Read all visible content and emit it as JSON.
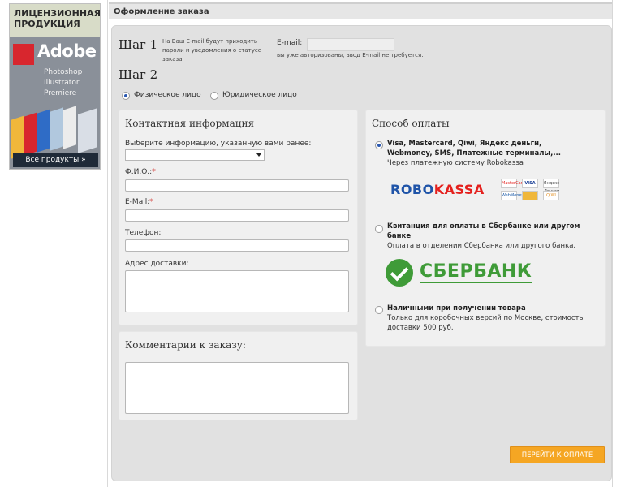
{
  "banner": {
    "heading": "ЛИЦЕНЗИОННАЯ ПРОДУКЦИЯ",
    "brand": "Adobe",
    "products": [
      "Photoshop",
      "Illustrator",
      "Premiere"
    ],
    "button": "Все продукты »"
  },
  "section": {
    "title": "Оформление заказа"
  },
  "step1": {
    "label": "Шаг 1",
    "note": "На Ваш E-mail будут приходить пароли и уведомления о статусе заказа.",
    "email_label": "E-mail:",
    "email_value": "",
    "email_note": "вы уже авторизованы, ввод E-mail не требуется."
  },
  "step2": {
    "label": "Шаг 2",
    "person_individual": "Физическое лицо",
    "person_legal": "Юридическое лицо"
  },
  "contact": {
    "title": "Контактная информация",
    "select_label": "Выберите информацию, указанную вами ранее:",
    "name_label": "Ф.И.О.:",
    "email_label": "E-Mail:",
    "phone_label": "Телефон:",
    "address_label": "Адрес доставки:",
    "required_mark": "*"
  },
  "comments": {
    "title": "Комментарии к заказу:"
  },
  "payment": {
    "title": "Способ оплаты",
    "options": [
      {
        "title": "Visa, Mastercard, Qiwi, Яндекс деньги, Webmoney, SMS, Платежные терминалы,...",
        "desc": "Через платежную систему Robokassa",
        "selected": true
      },
      {
        "title": "Квитанция для оплаты в Сбербанке или другом банке",
        "desc": "Оплата в отделении Сбербанка или другого банка.",
        "selected": false
      },
      {
        "title": "Наличными при получении товара",
        "desc": "Только для коробочных версий по Москве, стоимость доставки 500 руб.",
        "selected": false
      }
    ],
    "robokassa_a": "ROBO",
    "robokassa_b": "KASSA",
    "sberbank": "СБЕРБАНК",
    "cards": [
      "MasterCard",
      "VISA",
      "Яндекс Деньги",
      "WebMoney",
      "",
      "QIWI"
    ]
  },
  "submit": {
    "label": "ПЕРЕЙТИ К ОПЛАТЕ"
  },
  "colors": {
    "accent": "#f5a623",
    "sber": "#3f9b38",
    "robo_blue": "#1f54a8",
    "robo_red": "#e4201d"
  }
}
